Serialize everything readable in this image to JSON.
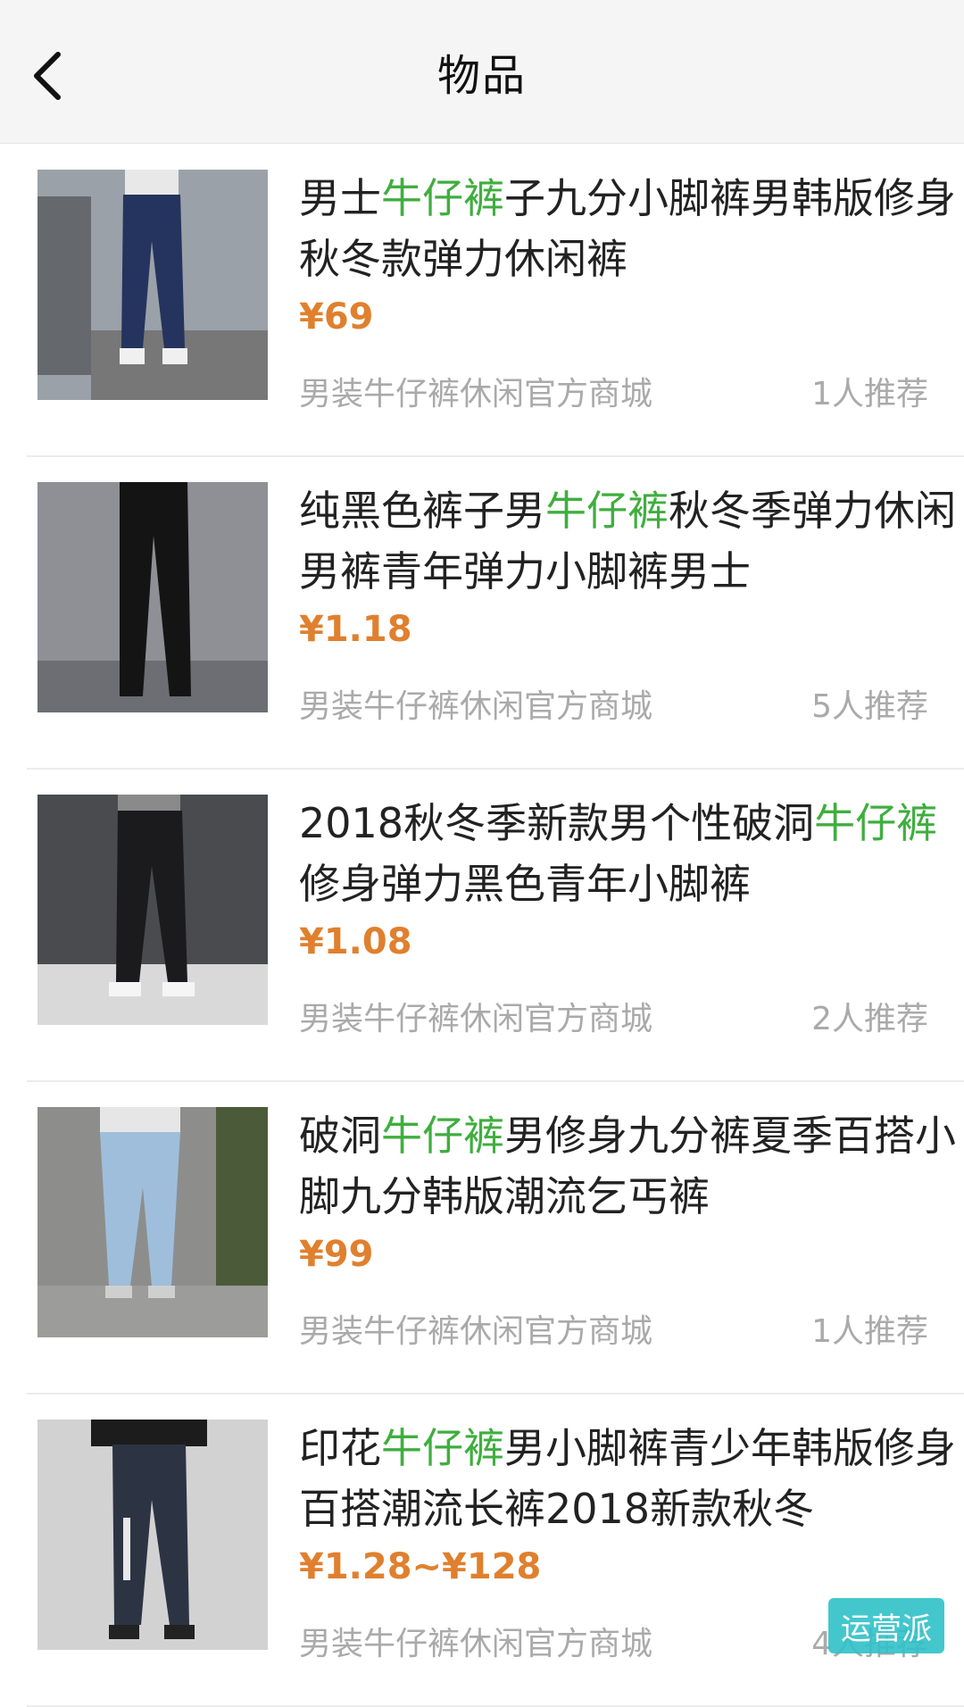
{
  "header": {
    "title": "物品"
  },
  "items": [
    {
      "title_segments": [
        "男士",
        "牛仔裤",
        "子九分小脚裤男韩版修身秋冬款弹力休闲裤"
      ],
      "price": "¥69",
      "shop": "男装牛仔裤休闲官方商城",
      "recommend": "1人推荐",
      "image": "light-blue-jeans-photo"
    },
    {
      "title_segments": [
        "纯黑色裤子男",
        "牛仔裤",
        "秋冬季弹力休闲男裤青年弹力小脚裤男士"
      ],
      "price": "¥1.18",
      "shop": "男装牛仔裤休闲官方商城",
      "recommend": "5人推荐",
      "image": "black-jeans-photo"
    },
    {
      "title_segments": [
        "2018秋冬季新款男个性破洞",
        "牛仔裤",
        "修身弹力黑色青年小脚裤"
      ],
      "price": "¥1.08",
      "shop": "男装牛仔裤休闲官方商城",
      "recommend": "2人推荐",
      "image": "ripped-black-jeans-photo"
    },
    {
      "title_segments": [
        "破洞",
        "牛仔裤",
        "男修身九分裤夏季百搭小脚九分韩版潮流乞丐裤"
      ],
      "price": "¥99",
      "shop": "男装牛仔裤休闲官方商城",
      "recommend": "1人推荐",
      "image": "light-washed-jeans-photo"
    },
    {
      "title_segments": [
        "印花",
        "牛仔裤",
        "男小脚裤青少年韩版修身百搭潮流长裤2018新款秋冬"
      ],
      "price": "¥1.28~¥128",
      "shop": "男装牛仔裤休闲官方商城",
      "recommend": "4人推荐",
      "image": "printed-dark-jeans-photo"
    }
  ],
  "watermark": {
    "text": "运营派"
  },
  "colors": {
    "highlight": "#3fae3f",
    "price": "#e0802e",
    "muted": "#aaaaaa"
  }
}
